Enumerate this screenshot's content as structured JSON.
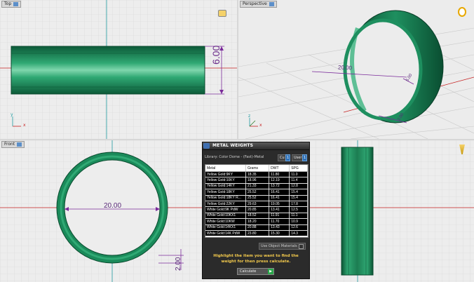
{
  "viewports": {
    "top": {
      "label": "Top",
      "dimension": "6.00"
    },
    "perspective": {
      "label": "Perspective",
      "dimension_main": "20.00",
      "dimension_side": "6.00",
      "dimension_small": "2.00"
    },
    "front": {
      "label": "Front",
      "dimension_main": "20.00",
      "dimension_small": "2.00"
    }
  },
  "axes": {
    "x": "x",
    "y": "y",
    "z": "z"
  },
  "metal_panel": {
    "title": "METAL WEIGHTS",
    "library": "Library: Color Dome - (Fast)-Metal",
    "toggle_1": "Cu",
    "toggle_2": "User",
    "columns": [
      "Metal",
      "Grams",
      "DWT",
      "SPG"
    ],
    "rows": [
      [
        "Yellow Gold:9KY",
        "18.35",
        "11.80",
        "11.0"
      ],
      [
        "Yellow Gold:10KY",
        "18.96",
        "12.19",
        "11.4"
      ],
      [
        "Yellow Gold:14KY",
        "21.33",
        "13.72",
        "12.8"
      ],
      [
        "Yellow Gold:18KY",
        "25.52",
        "16.41",
        "15.4"
      ],
      [
        "Yellow Gold:18KY R...",
        "25.52",
        "16.41",
        "15.4"
      ],
      [
        "Yellow Gold:22KY",
        "29.63",
        "19.05",
        "17.8"
      ],
      [
        "White Gold:9K PdW",
        "20.85",
        "13.41",
        "12.5"
      ],
      [
        "White Gold:10KX1",
        "18.52",
        "11.91",
        "11.1"
      ],
      [
        "White Gold:10KW",
        "18.20",
        "11.70",
        "10.9"
      ],
      [
        "White Gold:14KX1",
        "20.88",
        "13.43",
        "12.6"
      ],
      [
        "White Gold:14K PdW",
        "23.80",
        "15.30",
        "14.3"
      ]
    ],
    "use_object_materials": "Use Object Materials",
    "hint": "Highlight the item you want to find the weight for then press calculate.",
    "calculate": "Calculate"
  },
  "colors": {
    "ring_green": "#1a8a5a",
    "dim_purple": "#7a2a9a",
    "axis_red": "#c62020",
    "axis_teal": "#1f9aa0"
  }
}
